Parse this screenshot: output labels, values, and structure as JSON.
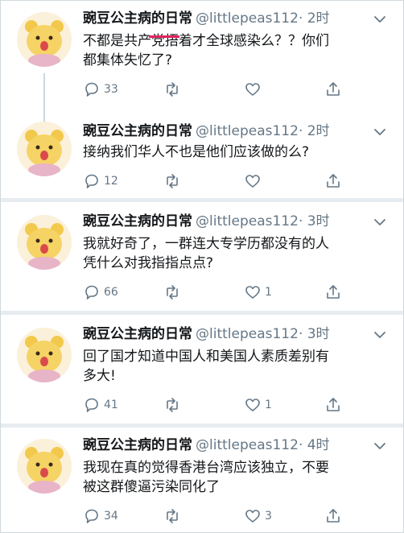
{
  "colors": {
    "accent": "#1da1f2",
    "secondary": "#657786",
    "underline": "#e0245e"
  },
  "tweets": [
    {
      "name": "豌豆公主病的日常",
      "handle": "@littlepeas112",
      "time": "· 2时",
      "text": "不都是共产党捂着才全球感染么？？你们\n都集体失忆了?",
      "reply_count": "33",
      "retweet_count": "",
      "like_count": ""
    },
    {
      "name": "豌豆公主病的日常",
      "handle": "@littlepeas112",
      "time": "· 2时",
      "text": "接纳我们华人不也是他们应该做的么?",
      "reply_count": "12",
      "retweet_count": "",
      "like_count": ""
    },
    {
      "name": "豌豆公主病的日常",
      "handle": "@littlepeas112",
      "time": "· 3时",
      "text": "我就好奇了，一群连大专学历都没有的人\n凭什么对我指指点点?",
      "reply_count": "66",
      "retweet_count": "",
      "like_count": "1"
    },
    {
      "name": "豌豆公主病的日常",
      "handle": "@littlepeas112",
      "time": "· 3时",
      "text": "回了国才知道中国人和美国人素质差别有\n多大!",
      "reply_count": "41",
      "retweet_count": "",
      "like_count": "1"
    },
    {
      "name": "豌豆公主病的日常",
      "handle": "@littlepeas112",
      "time": "· 4时",
      "text": "我现在真的觉得香港台湾应该独立，不要\n被这群傻逼污染同化了",
      "reply_count": "34",
      "retweet_count": "",
      "like_count": "3"
    }
  ]
}
